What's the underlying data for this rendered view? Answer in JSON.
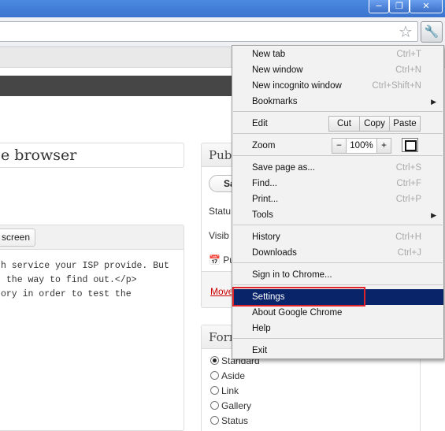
{
  "window": {
    "minimize_icon": "minimize-icon",
    "maximize_icon": "restore-icon",
    "close_icon": "close-icon"
  },
  "toolbar": {
    "star_icon": "bookmark-star-icon",
    "wrench_icon": "wrench-icon"
  },
  "page": {
    "title_value": "e browser",
    "fullscreen_label": "screen",
    "editor_lines": [
      "h service your ISP provide. But",
      " the way to find out.</p>",
      "ory in order to test the"
    ],
    "publish": {
      "heading": "Publ",
      "save_label": "Sa",
      "status_label": "Statu",
      "visibility_label": "Visib",
      "published_label": "Pu",
      "move_link": "Move"
    },
    "format": {
      "heading": "Forn",
      "options": [
        "Standard",
        "Aside",
        "Link",
        "Gallery",
        "Status"
      ],
      "selected": "Standard"
    }
  },
  "menu": {
    "new_tab": {
      "label": "New tab",
      "shortcut": "Ctrl+T"
    },
    "new_window": {
      "label": "New window",
      "shortcut": "Ctrl+N"
    },
    "new_incognito": {
      "label": "New incognito window",
      "shortcut": "Ctrl+Shift+N"
    },
    "bookmarks": {
      "label": "Bookmarks"
    },
    "edit": {
      "label": "Edit",
      "cut": "Cut",
      "copy": "Copy",
      "paste": "Paste"
    },
    "zoom": {
      "label": "Zoom",
      "minus": "−",
      "value": "100%",
      "plus": "+"
    },
    "save_page": {
      "label": "Save page as...",
      "shortcut": "Ctrl+S"
    },
    "find": {
      "label": "Find...",
      "shortcut": "Ctrl+F"
    },
    "print": {
      "label": "Print...",
      "shortcut": "Ctrl+P"
    },
    "tools": {
      "label": "Tools"
    },
    "history": {
      "label": "History",
      "shortcut": "Ctrl+H"
    },
    "downloads": {
      "label": "Downloads",
      "shortcut": "Ctrl+J"
    },
    "sign_in": {
      "label": "Sign in to Chrome..."
    },
    "settings": {
      "label": "Settings"
    },
    "about": {
      "label": "About Google Chrome"
    },
    "help": {
      "label": "Help"
    },
    "exit": {
      "label": "Exit"
    }
  }
}
